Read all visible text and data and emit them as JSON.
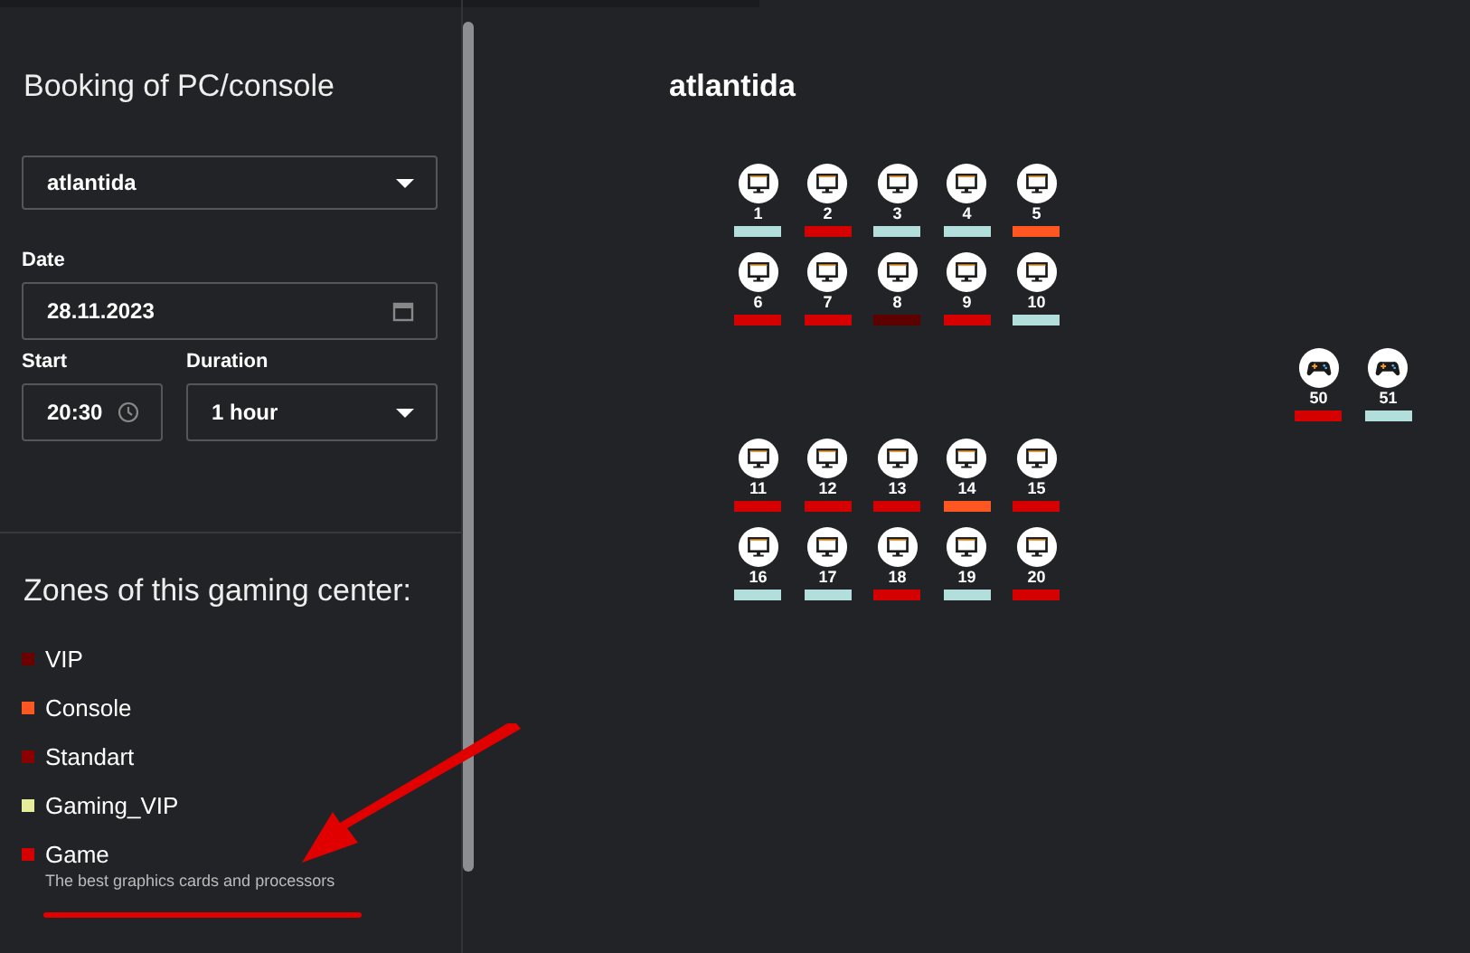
{
  "sidebar": {
    "title": "Booking of PC/console",
    "club_select": {
      "value": "atlantida"
    },
    "date": {
      "label": "Date",
      "value": "28.11.2023"
    },
    "start": {
      "label": "Start",
      "value": "20:30"
    },
    "duration": {
      "label": "Duration",
      "value": "1 hour"
    },
    "zones_title": "Zones of this gaming center:",
    "zones": [
      {
        "name": "VIP",
        "color": "#6b0000"
      },
      {
        "name": "Console",
        "color": "#ff5722"
      },
      {
        "name": "Standart",
        "color": "#8b0000"
      },
      {
        "name": "Gaming_VIP",
        "color": "#e6ee9c"
      },
      {
        "name": "Game",
        "color": "#d50000",
        "description": "The best graphics cards and processors"
      }
    ]
  },
  "map": {
    "title": "atlantida",
    "blocks": [
      {
        "seats": [
          {
            "kind": "pc",
            "number": "1",
            "color": "#b2dfdb"
          },
          {
            "kind": "pc",
            "number": "2",
            "color": "#d50000"
          },
          {
            "kind": "pc",
            "number": "3",
            "color": "#b2dfdb"
          },
          {
            "kind": "pc",
            "number": "4",
            "color": "#b2dfdb"
          },
          {
            "kind": "pc",
            "number": "5",
            "color": "#ff5722"
          },
          {
            "kind": "pc",
            "number": "6",
            "color": "#d50000"
          },
          {
            "kind": "pc",
            "number": "7",
            "color": "#d50000"
          },
          {
            "kind": "pc",
            "number": "8",
            "color": "#5d0000"
          },
          {
            "kind": "pc",
            "number": "9",
            "color": "#d50000"
          },
          {
            "kind": "pc",
            "number": "10",
            "color": "#b2dfdb"
          }
        ]
      },
      {
        "seats": [
          {
            "kind": "console",
            "number": "50",
            "color": "#d50000"
          },
          {
            "kind": "console",
            "number": "51",
            "color": "#b2dfdb"
          }
        ]
      },
      {
        "seats": [
          {
            "kind": "pc",
            "number": "11",
            "color": "#d50000"
          },
          {
            "kind": "pc",
            "number": "12",
            "color": "#d50000"
          },
          {
            "kind": "pc",
            "number": "13",
            "color": "#d50000"
          },
          {
            "kind": "pc",
            "number": "14",
            "color": "#ff5722"
          },
          {
            "kind": "pc",
            "number": "15",
            "color": "#d50000"
          },
          {
            "kind": "pc",
            "number": "16",
            "color": "#b2dfdb"
          },
          {
            "kind": "pc",
            "number": "17",
            "color": "#b2dfdb"
          },
          {
            "kind": "pc",
            "number": "18",
            "color": "#d50000"
          },
          {
            "kind": "pc",
            "number": "19",
            "color": "#b2dfdb"
          },
          {
            "kind": "pc",
            "number": "20",
            "color": "#d50000"
          }
        ]
      }
    ]
  }
}
